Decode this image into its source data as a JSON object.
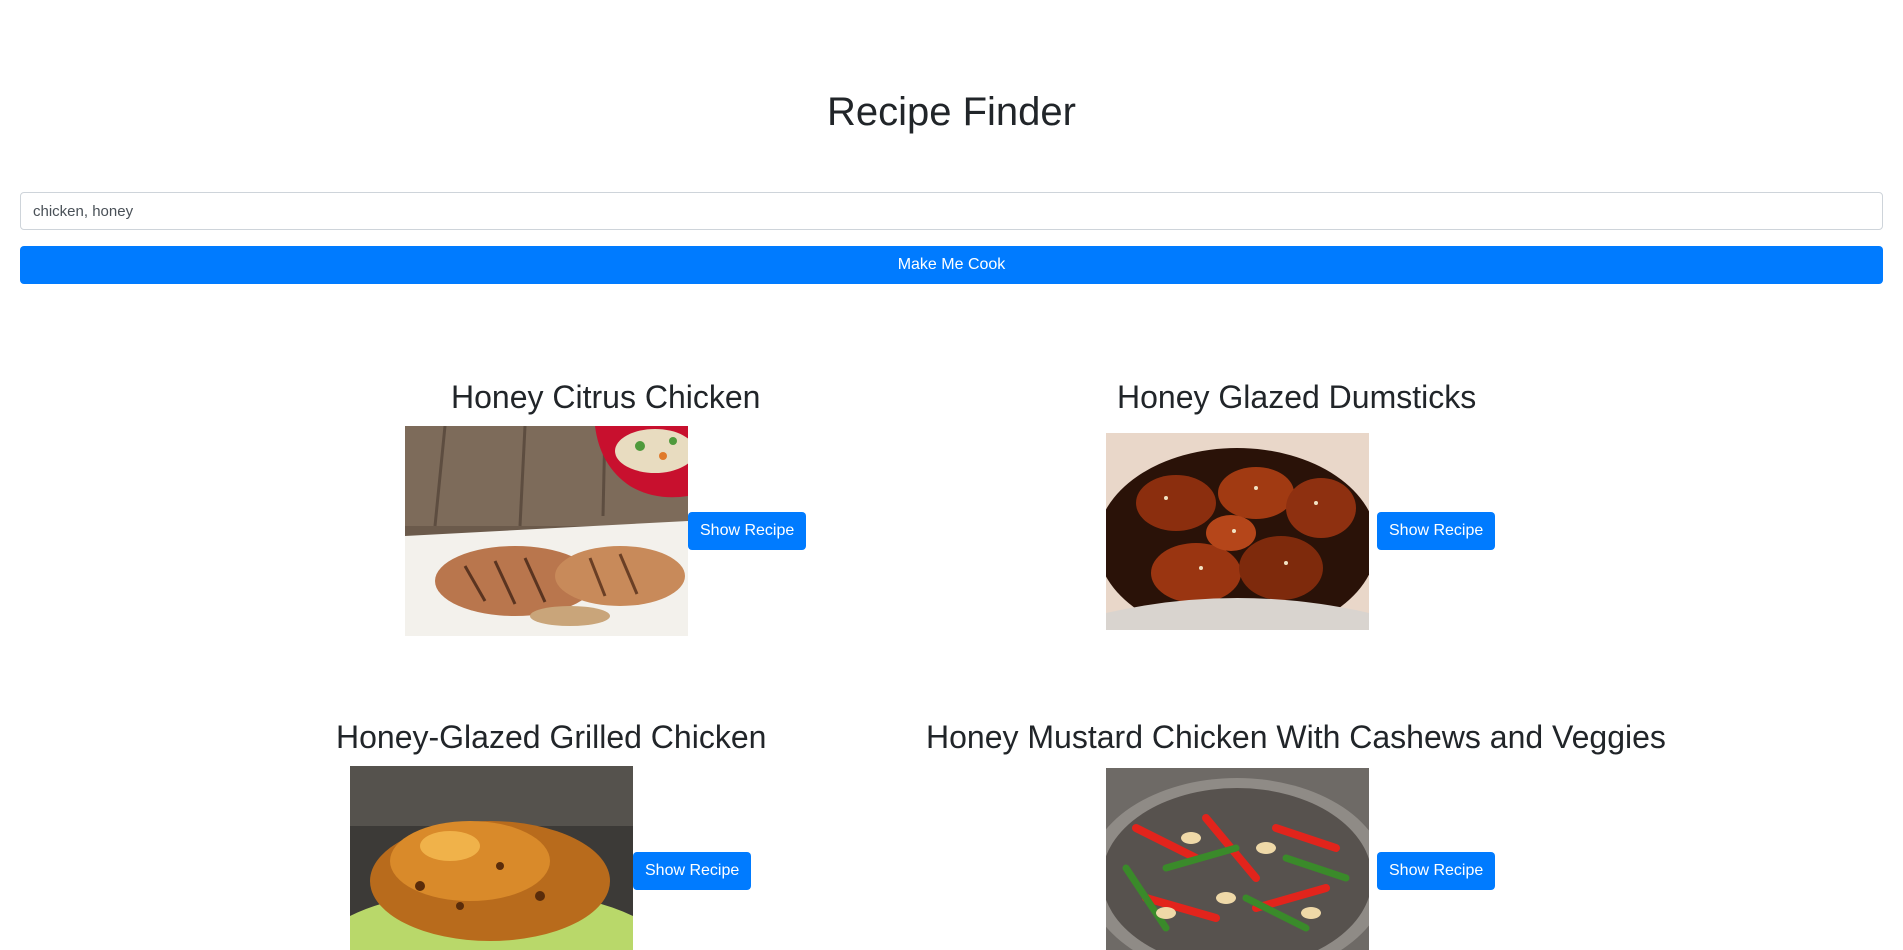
{
  "header": {
    "title": "Recipe Finder"
  },
  "search": {
    "value": "chicken, honey",
    "button_label": "Make Me Cook"
  },
  "results": [
    {
      "title": "Honey Citrus Chicken",
      "button_label": "Show Recipe",
      "image_alt": "Honey Citrus Chicken photo"
    },
    {
      "title": "Honey Glazed Dumsticks",
      "button_label": "Show Recipe",
      "image_alt": "Honey Glazed Dumsticks photo"
    },
    {
      "title": "Honey-Glazed Grilled Chicken",
      "button_label": "Show Recipe",
      "image_alt": "Honey-Glazed Grilled Chicken photo"
    },
    {
      "title": "Honey Mustard Chicken With Cashews and Veggies",
      "button_label": "Show Recipe",
      "image_alt": "Honey Mustard Chicken With Cashews and Veggies photo"
    }
  ],
  "colors": {
    "primary": "#007bff",
    "text": "#212529",
    "border": "#ced4da"
  }
}
